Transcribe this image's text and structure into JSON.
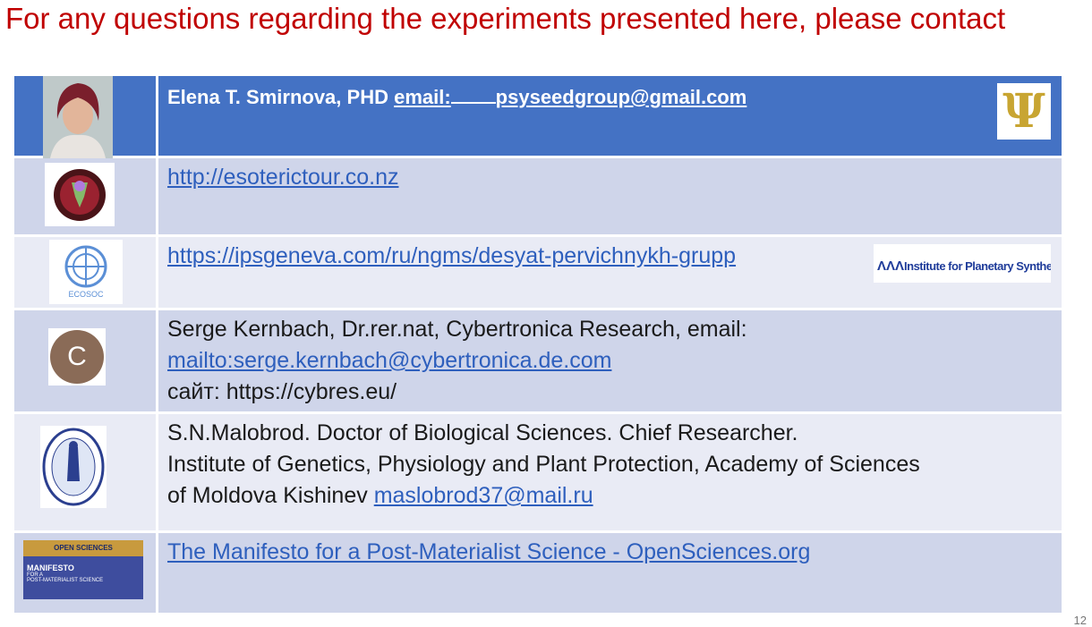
{
  "slide": {
    "title": "For any questions regarding the experiments presented here, please contact",
    "page_number": "12"
  },
  "rows": [
    {
      "name": "Elena T. Smirnova, PHD ",
      "email_label": "email:",
      "email": "psyseedgroup@gmail.com",
      "logo_text": "Ψ"
    },
    {
      "link": "http://esoterictour.co.nz"
    },
    {
      "link": "https://ipsgeneva.com/ru/ngms/desyat-pervichnykh-grupp",
      "logo_org_text": "Institute for Planetary Synthesis",
      "logo_un_text": "ECOSOC"
    },
    {
      "line1": "Serge Kernbach, Dr.rer.nat, Cybertronica Research, email:",
      "link": "mailto:serge.kernbach@cybertronica.de.com",
      "line3": "сайт: https://cybres.eu/",
      "avatar_letter": "C"
    },
    {
      "line1": "S.N.Malobrod. Doctor of Biological Sciences. Chief Researcher.",
      "line2": "Institute of Genetics, Physiology and Plant Protection, Academy of Sciences",
      "line3_prefix": "of Moldova Kishinev ",
      "link": "maslobrod37@mail.ru"
    },
    {
      "link": "The Manifesto for a Post-Materialist Science - OpenSciences.org",
      "thumb_top": "OPEN SCIENCES",
      "thumb_title": "MANIFESTO",
      "thumb_sub1": "FOR A",
      "thumb_sub2": "POST-MATERIALIST SCIENCE"
    }
  ],
  "colors": {
    "title": "#c00000",
    "header_row": "#4472c4",
    "row_dark": "#cfd5ea",
    "row_light": "#e9ebf5",
    "link": "#2e5fbd"
  }
}
